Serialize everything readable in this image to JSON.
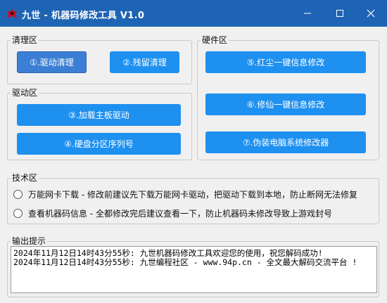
{
  "window": {
    "title": "九世 - 机器码修改工具 V1.0",
    "icon": "app-logo-icon",
    "controls": {
      "minimize_icon": "minimize-icon",
      "maximize_icon": "maximize-icon",
      "close_icon": "close-icon"
    }
  },
  "clean_group": {
    "title": "清理区",
    "buttons": [
      {
        "label": "①.驱动清理",
        "state": "pressed"
      },
      {
        "label": "②.残留清理"
      }
    ]
  },
  "driver_group": {
    "title": "驱动区",
    "buttons": [
      {
        "label": "③.加载主板驱动"
      },
      {
        "label": "④.硬盘分区序列号"
      }
    ]
  },
  "hardware_group": {
    "title": "硬件区",
    "buttons": [
      {
        "label": "⑤.红尘一键信息修改"
      },
      {
        "label": "⑥.修仙一键信息修改"
      },
      {
        "label": "⑦.伪装电脑系统修改器"
      }
    ]
  },
  "tech_group": {
    "title": "技术区",
    "options": [
      {
        "label": "万能网卡下载 - 修改前建议先下载万能网卡驱动，把驱动下载到本地，防止断网无法修复",
        "selected": false
      },
      {
        "label": "查看机器码信息 - 全都修改完后建议查看一下，防止机器码未修改导致上游戏封号",
        "selected": false
      }
    ]
  },
  "output_group": {
    "title": "输出提示",
    "lines": [
      "2024年11月12日14时43分55秒: 九世机器码修改工具欢迎您的使用，祝您解码成功!",
      "2024年11月12日14时43分55秒: 九世编程社区 - www.94p.cn - 全文最大解码交流平台 !"
    ]
  },
  "colors": {
    "titlebar": "#1e64b4",
    "button": "#1e90f0",
    "button_pressed": "#3b7fd4",
    "background": "#f0f0f0"
  }
}
